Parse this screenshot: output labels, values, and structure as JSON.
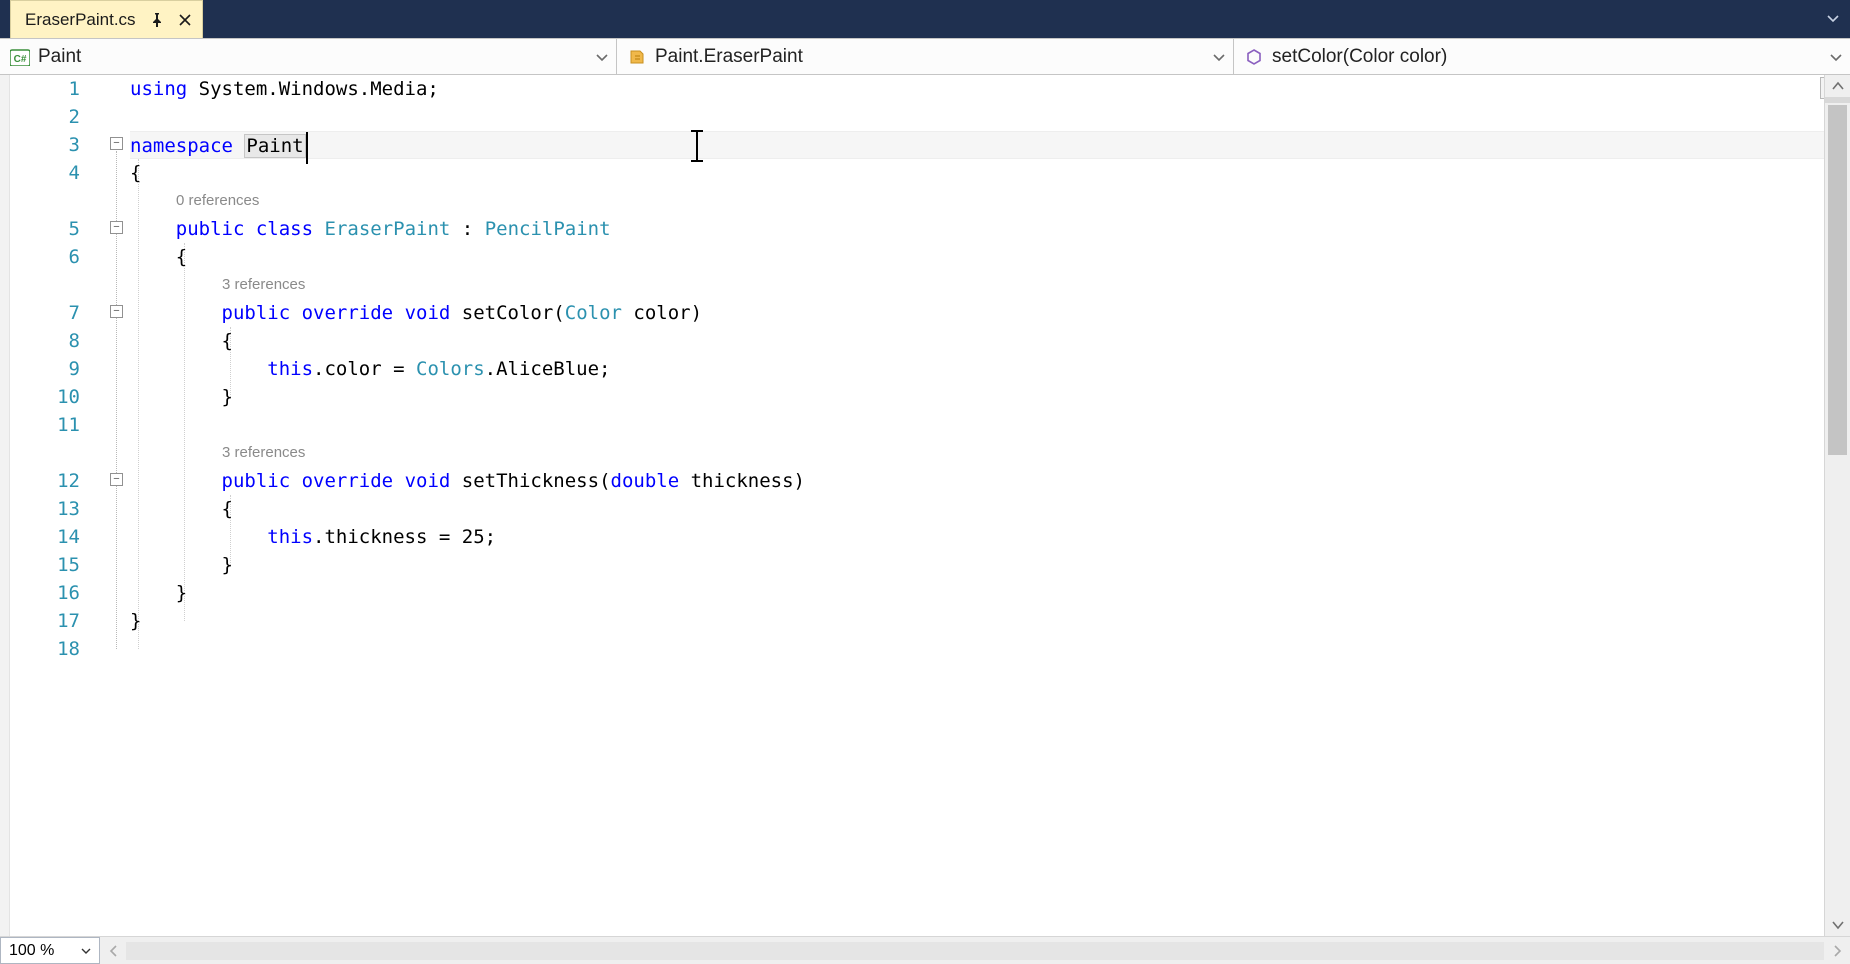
{
  "tab": {
    "title": "EraserPaint.cs"
  },
  "nav": {
    "project": "Paint",
    "type": "Paint.EraserPaint",
    "member": "setColor(Color color)"
  },
  "zoom": "100 %",
  "codelens": {
    "class": "0 references",
    "setColor": "3 references",
    "setThickness": "3 references"
  },
  "code": {
    "l1": {
      "kw1": "using",
      "rest": " System.Windows.Media;"
    },
    "l3": {
      "kw1": "namespace",
      "sp": " ",
      "name": "Paint"
    },
    "l4": "{",
    "l5": {
      "pad": "    ",
      "kw1": "public",
      "sp1": " ",
      "kw2": "class",
      "sp2": " ",
      "t1": "EraserPaint",
      "sep": " : ",
      "t2": "PencilPaint"
    },
    "l6": "    {",
    "l7": {
      "pad": "        ",
      "kw1": "public",
      "sp1": " ",
      "kw2": "override",
      "sp2": " ",
      "kw3": "void",
      "sp3": " ",
      "name": "setColor(",
      "t1": "Color",
      "rest": " color)"
    },
    "l8": "        {",
    "l9": {
      "pad": "            ",
      "kw1": "this",
      "mid": ".color = ",
      "t1": "Colors",
      "rest": ".AliceBlue;"
    },
    "l10": "        }",
    "l12": {
      "pad": "        ",
      "kw1": "public",
      "sp1": " ",
      "kw2": "override",
      "sp2": " ",
      "kw3": "void",
      "sp3": " ",
      "name": "setThickness(",
      "t1": "double",
      "rest": " thickness)"
    },
    "l13": "        {",
    "l14": {
      "pad": "            ",
      "kw1": "this",
      "rest": ".thickness = 25;"
    },
    "l15": "        }",
    "l16": "    }",
    "l17": "}"
  },
  "line_numbers": [
    "1",
    "2",
    "3",
    "4",
    "5",
    "6",
    "7",
    "8",
    "9",
    "10",
    "11",
    "12",
    "13",
    "14",
    "15",
    "16",
    "17",
    "18"
  ]
}
